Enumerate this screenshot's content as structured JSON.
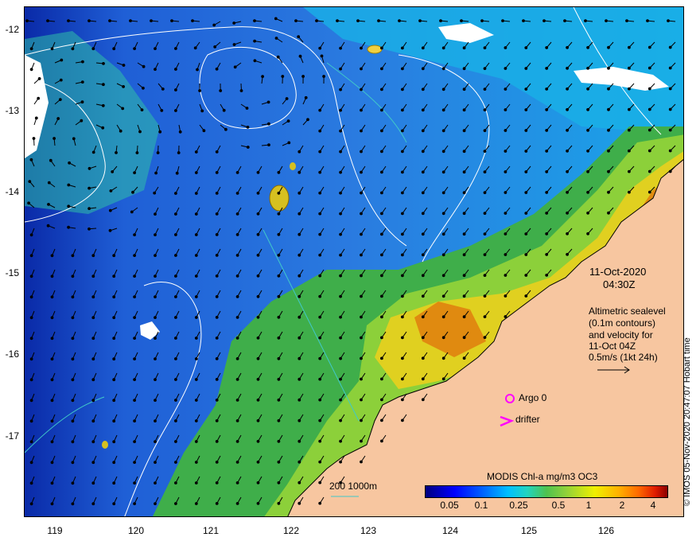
{
  "map": {
    "lat_labels": [
      "-12",
      "-13",
      "-14",
      "-15",
      "-16",
      "-17"
    ],
    "lon_labels": [
      "119",
      "120",
      "121",
      "122",
      "123",
      "124",
      "125",
      "126"
    ],
    "date": "11-Oct-2020",
    "time": "04:30Z",
    "info_lines": [
      "Altimetric sealevel",
      "(0.1m contours)",
      "and velocity for",
      "11-Oct 04Z",
      "0.5m/s (1kt 24h)"
    ],
    "argo_label": "Argo 0",
    "drifter_label": "drifter",
    "depth_label": "200  1000m",
    "colorbar_title": "MODIS Chl-a mg/m3 OC3",
    "colorbar_ticks": [
      "0.05",
      "0.1",
      "0.25",
      "0.5",
      "1",
      "2",
      "4"
    ],
    "credit": "© IMOS 05-Nov-2020 20:47:07 Hobart time",
    "colors": {
      "land": "#f7c6a0",
      "ocean_blue": "#2a7be0",
      "shelf_green": "#3fae4a",
      "argo": "#ff00ff",
      "contour": "#ffffff",
      "depth": "#40c8c8"
    }
  }
}
